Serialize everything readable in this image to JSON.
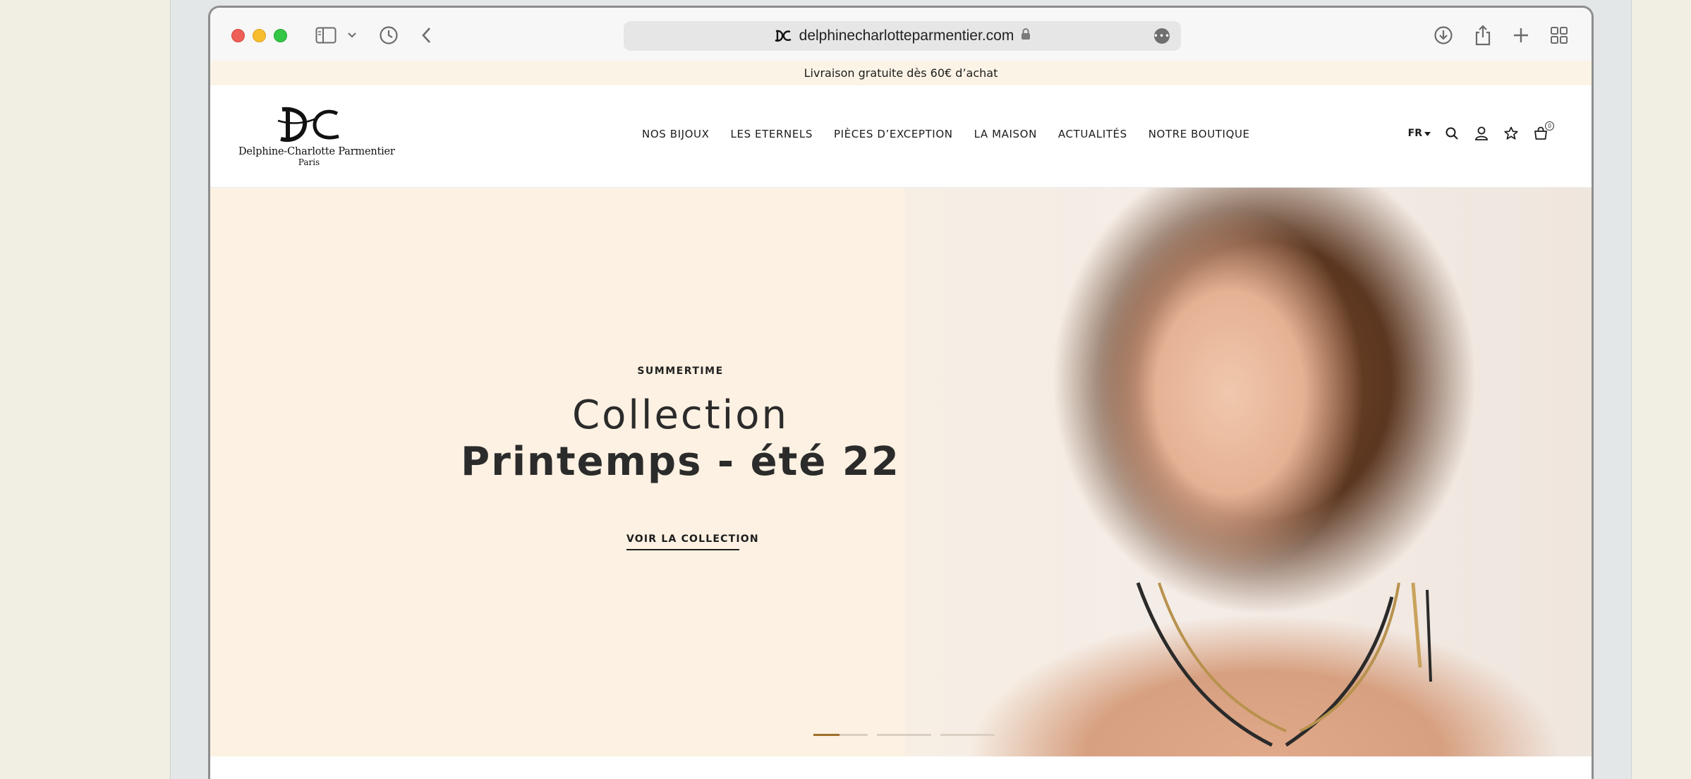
{
  "browser": {
    "url": "delphinecharlotteparmentier.com",
    "icons": {
      "sidebar": "sidebar-icon",
      "sidebar_menu": "chevron-down-icon",
      "history": "clock-icon",
      "back": "chevron-left-icon",
      "lock": "lock-icon",
      "more": "ellipsis-icon",
      "download": "download-icon",
      "share": "share-icon",
      "new_tab": "plus-icon",
      "tabs": "grid-icon"
    }
  },
  "promo": {
    "text": "Livraison gratuite dès 60€ d’achat"
  },
  "header": {
    "logo": {
      "name": "Delphine-Charlotte Parmentier",
      "city": "Paris"
    },
    "nav": [
      {
        "label": "NOS BIJOUX"
      },
      {
        "label": "LES ETERNELS"
      },
      {
        "label": "PIÈCES D’EXCEPTION"
      },
      {
        "label": "LA MAISON"
      },
      {
        "label": "ACTUALITÉS"
      },
      {
        "label": "NOTRE BOUTIQUE"
      }
    ],
    "lang": "FR",
    "cart_count": "0"
  },
  "hero": {
    "eyebrow": "SUMMERTIME",
    "title_line1": "Collection",
    "title_line2": "Printemps - été 22",
    "cta": "VOIR LA COLLECTION",
    "slides_total": 3,
    "slide_active": 1
  },
  "colors": {
    "hero_bg": "#fcf1e2",
    "promo_bg": "#fbf4e6",
    "accent_gold": "#a06f2b",
    "text_dark": "#1c1c1c"
  }
}
